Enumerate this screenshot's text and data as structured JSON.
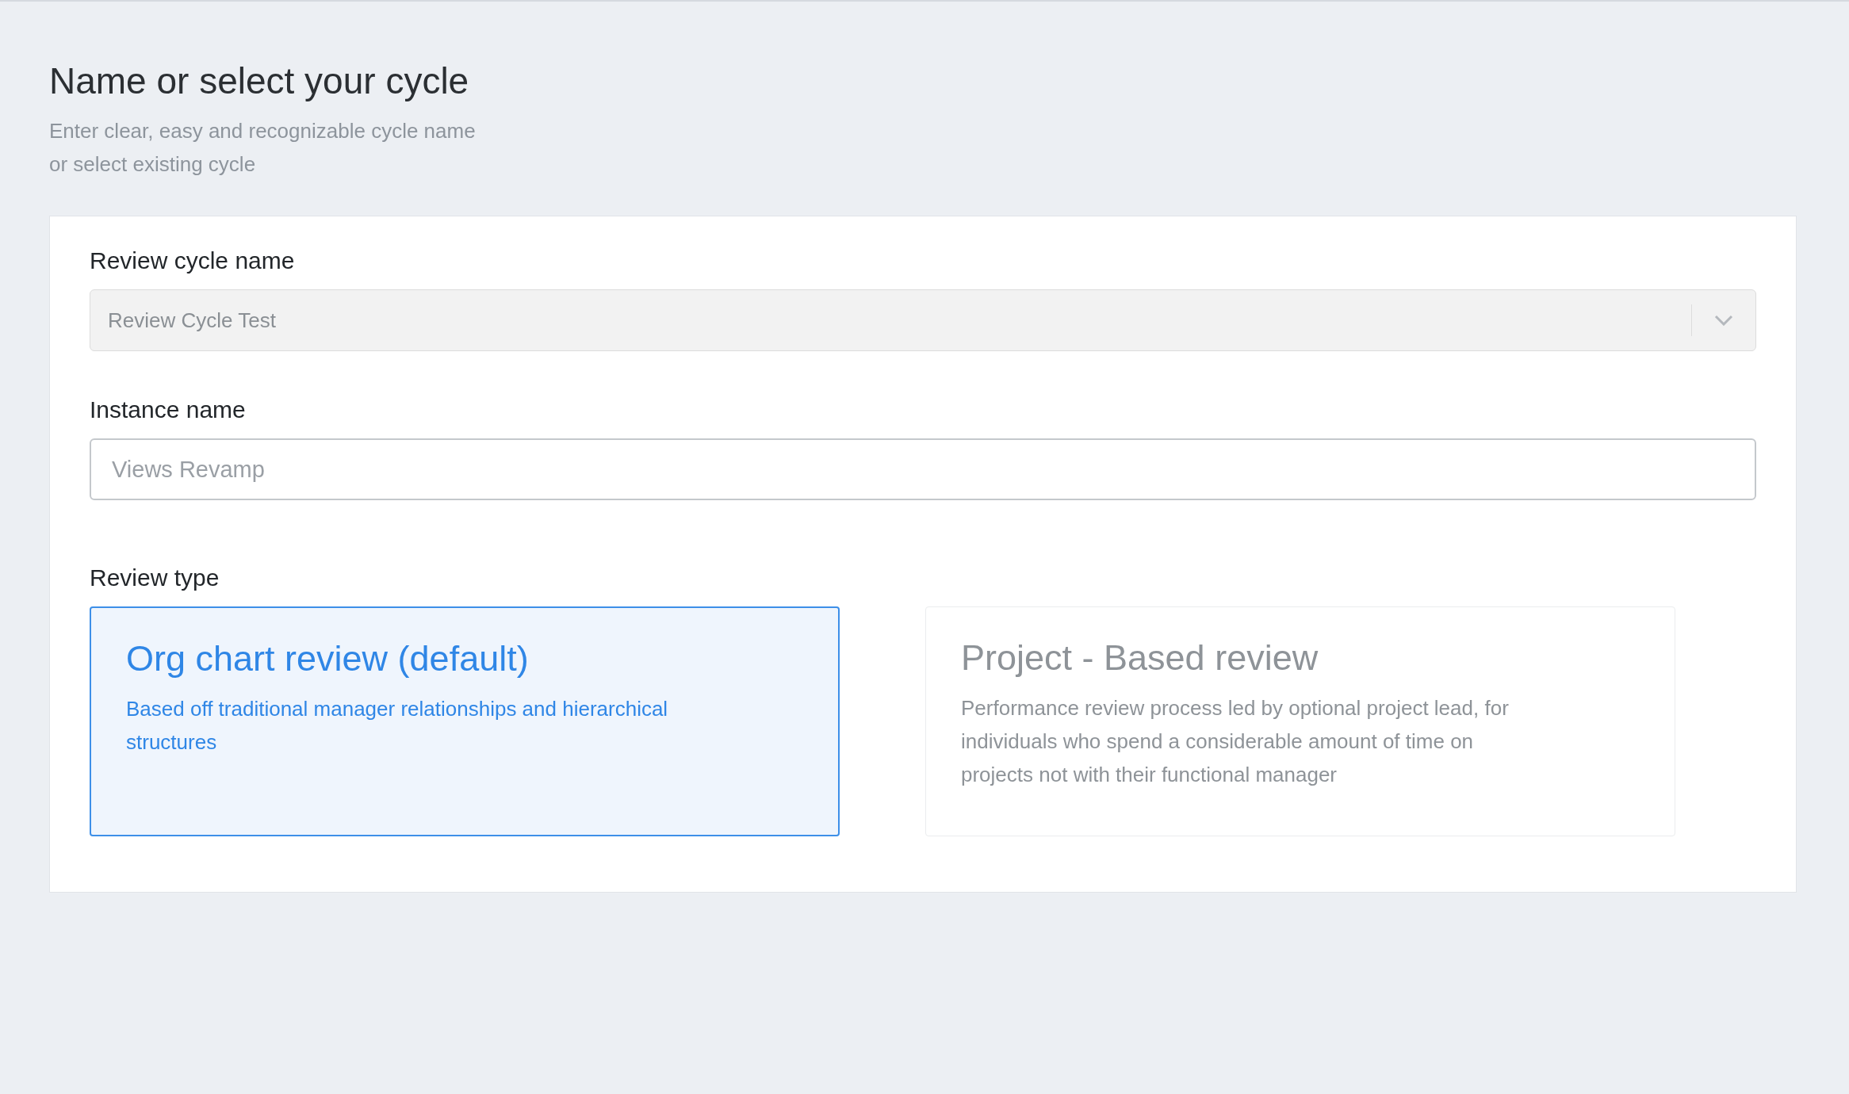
{
  "header": {
    "title": "Name or select your cycle",
    "subtitle": "Enter clear, easy and recognizable cycle name or select existing cycle"
  },
  "review_cycle": {
    "label": "Review cycle name",
    "value": "Review Cycle Test",
    "disabled": true
  },
  "instance": {
    "label": "Instance name",
    "placeholder": "Views Revamp"
  },
  "review_type": {
    "label": "Review type",
    "options": [
      {
        "title": "Org chart review (default)",
        "description": "Based off traditional manager relationships and hierarchical structures",
        "selected": true
      },
      {
        "title": "Project - Based review",
        "description": "Performance review process led by optional project lead, for individuals who spend a considerable amount of time on projects not with their functional manager",
        "selected": false
      }
    ]
  }
}
